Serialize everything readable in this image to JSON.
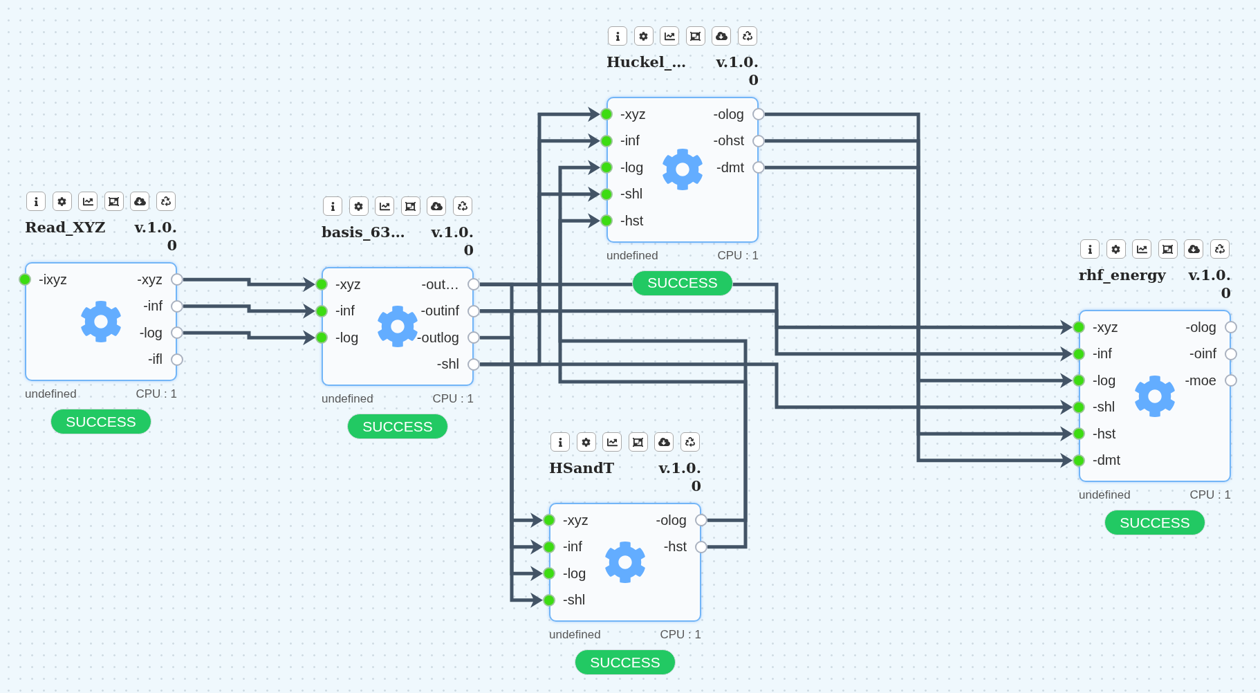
{
  "nodes": [
    {
      "name": "Read_XYZ",
      "version": "v.1.0.0",
      "inputs": [
        "-ixyz"
      ],
      "outputs": [
        "-xyz",
        "-inf",
        "-log",
        "-ifl"
      ],
      "info": "undefined",
      "cpu": "CPU : 1",
      "status": {
        "label": "SUCCESS",
        "kind": "success"
      }
    },
    {
      "name": "basis_63…",
      "version": "v.1.0.0",
      "inputs": [
        "-xyz",
        "-inf",
        "-log"
      ],
      "outputs": [
        "-out…",
        "-outinf",
        "-outlog",
        "-shl"
      ],
      "info": "undefined",
      "cpu": "CPU : 1",
      "status": {
        "label": "SUCCESS",
        "kind": "success"
      }
    },
    {
      "name": "Huckel_…",
      "version": "v.1.0.0",
      "inputs": [
        "-xyz",
        "-inf",
        "-log",
        "-shl",
        "-hst"
      ],
      "outputs": [
        "-olog",
        "-ohst",
        "-dmt"
      ],
      "info": "undefined",
      "cpu": "CPU : 1",
      "status": {
        "label": "SUCCESS",
        "kind": "success"
      }
    },
    {
      "name": "HSandT",
      "version": "v.1.0.0",
      "inputs": [
        "-xyz",
        "-inf",
        "-log",
        "-shl"
      ],
      "outputs": [
        "-olog",
        "-hst"
      ],
      "info": "undefined",
      "cpu": "CPU : 1",
      "status": {
        "label": "SUCCESS",
        "kind": "success"
      }
    },
    {
      "name": "rhf_energy",
      "version": "v.1.0.0",
      "inputs": [
        "-xyz",
        "-inf",
        "-log",
        "-shl",
        "-hst",
        "-dmt"
      ],
      "outputs": [
        "-olog",
        "-oinf",
        "-moe"
      ],
      "info": "undefined",
      "cpu": "CPU : 1",
      "status": {
        "label": "SUCCESS",
        "kind": "success"
      }
    }
  ]
}
